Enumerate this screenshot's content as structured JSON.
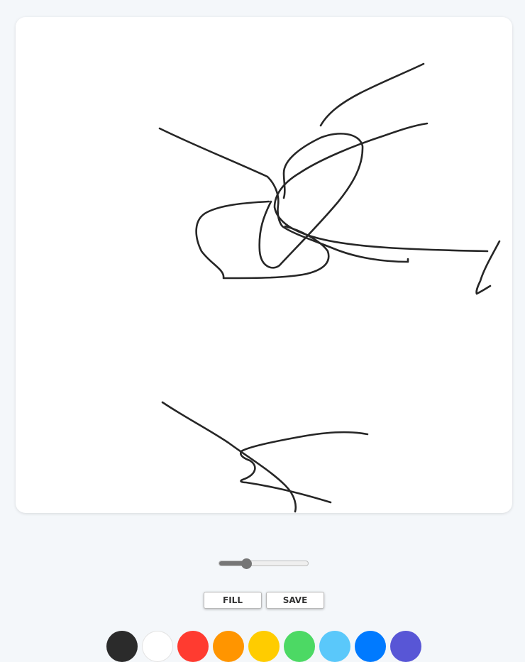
{
  "toolbar": {
    "fill_label": "FILL",
    "save_label": "SAVE"
  },
  "brush": {
    "size_fraction": 0.3
  },
  "palette": {
    "colors": [
      "#2b2b2b",
      "#ffffff",
      "#ff3b30",
      "#ff9500",
      "#ffcc00",
      "#4cd964",
      "#5ac8fa",
      "#007aff",
      "#5856d6"
    ]
  }
}
